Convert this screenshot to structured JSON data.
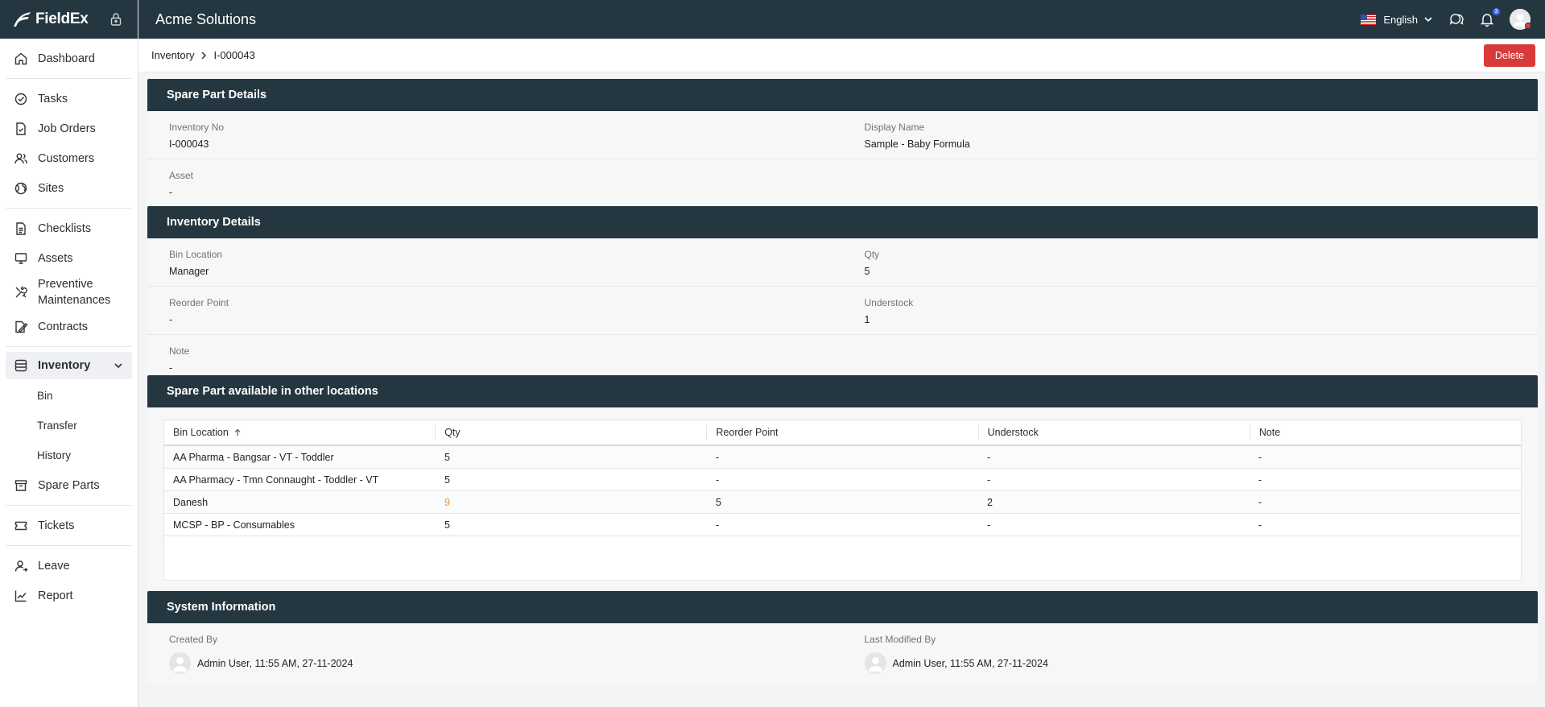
{
  "app": {
    "brand": "FieldEx",
    "org": "Acme Solutions"
  },
  "topbar": {
    "language": "English",
    "notification_count": "3"
  },
  "sidebar": {
    "items": [
      {
        "label": "Dashboard"
      },
      {
        "label": "Tasks"
      },
      {
        "label": "Job Orders"
      },
      {
        "label": "Customers"
      },
      {
        "label": "Sites"
      },
      {
        "label": "Checklists"
      },
      {
        "label": "Assets"
      },
      {
        "label": "Preventive Maintenances"
      },
      {
        "label": "Contracts"
      },
      {
        "label": "Inventory"
      },
      {
        "label": "Spare Parts"
      },
      {
        "label": "Tickets"
      },
      {
        "label": "Leave"
      },
      {
        "label": "Report"
      }
    ],
    "inventory_sub": [
      {
        "label": "Bin"
      },
      {
        "label": "Transfer"
      },
      {
        "label": "History"
      }
    ]
  },
  "breadcrumb": {
    "parent": "Inventory",
    "current": "I-000043"
  },
  "actions": {
    "delete_label": "Delete"
  },
  "spare_part": {
    "title": "Spare Part Details",
    "inventory_no_label": "Inventory No",
    "inventory_no": "I-000043",
    "display_name_label": "Display Name",
    "display_name": "Sample - Baby Formula",
    "asset_label": "Asset",
    "asset": "-"
  },
  "inventory": {
    "title": "Inventory Details",
    "bin_location_label": "Bin Location",
    "bin_location": "Manager",
    "qty_label": "Qty",
    "qty": "5",
    "reorder_point_label": "Reorder Point",
    "reorder_point": "-",
    "understock_label": "Understock",
    "understock": "1",
    "note_label": "Note",
    "note": "-"
  },
  "other_locations": {
    "title": "Spare Part available in other locations",
    "columns": [
      "Bin Location",
      "Qty",
      "Reorder Point",
      "Understock",
      "Note"
    ],
    "rows": [
      {
        "bin": "AA Pharma - Bangsar - VT - Toddler",
        "qty": "5",
        "reorder": "-",
        "understock": "-",
        "note": "-"
      },
      {
        "bin": "AA Pharmacy - Tmn Connaught - Toddler - VT",
        "qty": "5",
        "reorder": "-",
        "understock": "-",
        "note": "-"
      },
      {
        "bin": "Danesh",
        "qty": "9",
        "reorder": "5",
        "understock": "2",
        "note": "-"
      },
      {
        "bin": "MCSP - BP - Consumables",
        "qty": "5",
        "reorder": "-",
        "understock": "-",
        "note": "-"
      }
    ]
  },
  "system_info": {
    "title": "System Information",
    "created_label": "Created By",
    "created_value": "Admin User, 11:55 AM, 27-11-2024",
    "modified_label": "Last Modified By",
    "modified_value": "Admin User, 11:55 AM, 27-11-2024"
  },
  "colors": {
    "header_bg": "#243640",
    "link": "#5468d4",
    "danger": "#d83a3a",
    "warning_qty": "#f0932b"
  }
}
